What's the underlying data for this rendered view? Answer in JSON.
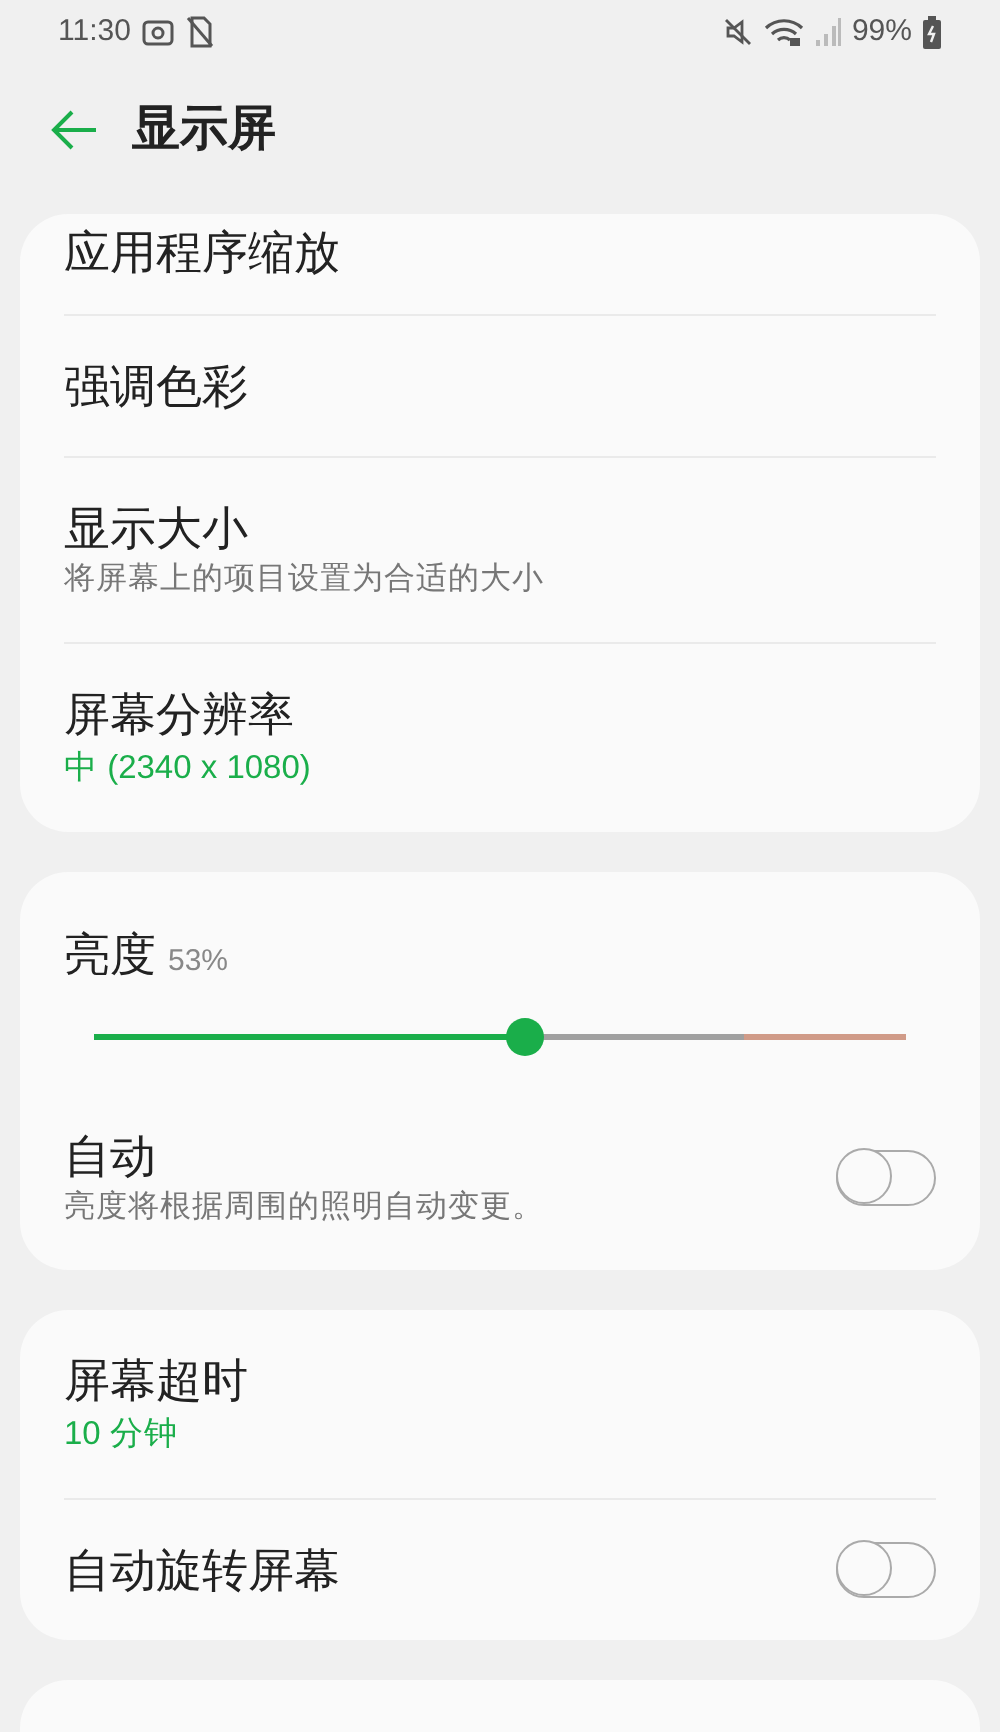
{
  "status_bar": {
    "time": "11:30",
    "battery": "99%"
  },
  "header": {
    "title": "显示屏"
  },
  "sections": [
    {
      "items": [
        {
          "kind": "nav",
          "title": "应用程序缩放"
        },
        {
          "kind": "nav",
          "title": "强调色彩"
        },
        {
          "kind": "nav",
          "title": "显示大小",
          "subtitle": "将屏幕上的项目设置为合适的大小"
        },
        {
          "kind": "nav",
          "title": "屏幕分辨率",
          "value": "中 (2340 x 1080)"
        }
      ]
    },
    {
      "items": [
        {
          "kind": "slider",
          "title": "亮度",
          "reading": "53%",
          "level": 0.53
        },
        {
          "kind": "switch",
          "title": "自动",
          "subtitle": "亮度将根据周围的照明自动变更。",
          "on": false
        }
      ]
    },
    {
      "items": [
        {
          "kind": "nav",
          "title": "屏幕超时",
          "value": "10 分钟"
        },
        {
          "kind": "switch",
          "title": "自动旋转屏幕",
          "on": false
        }
      ]
    }
  ]
}
